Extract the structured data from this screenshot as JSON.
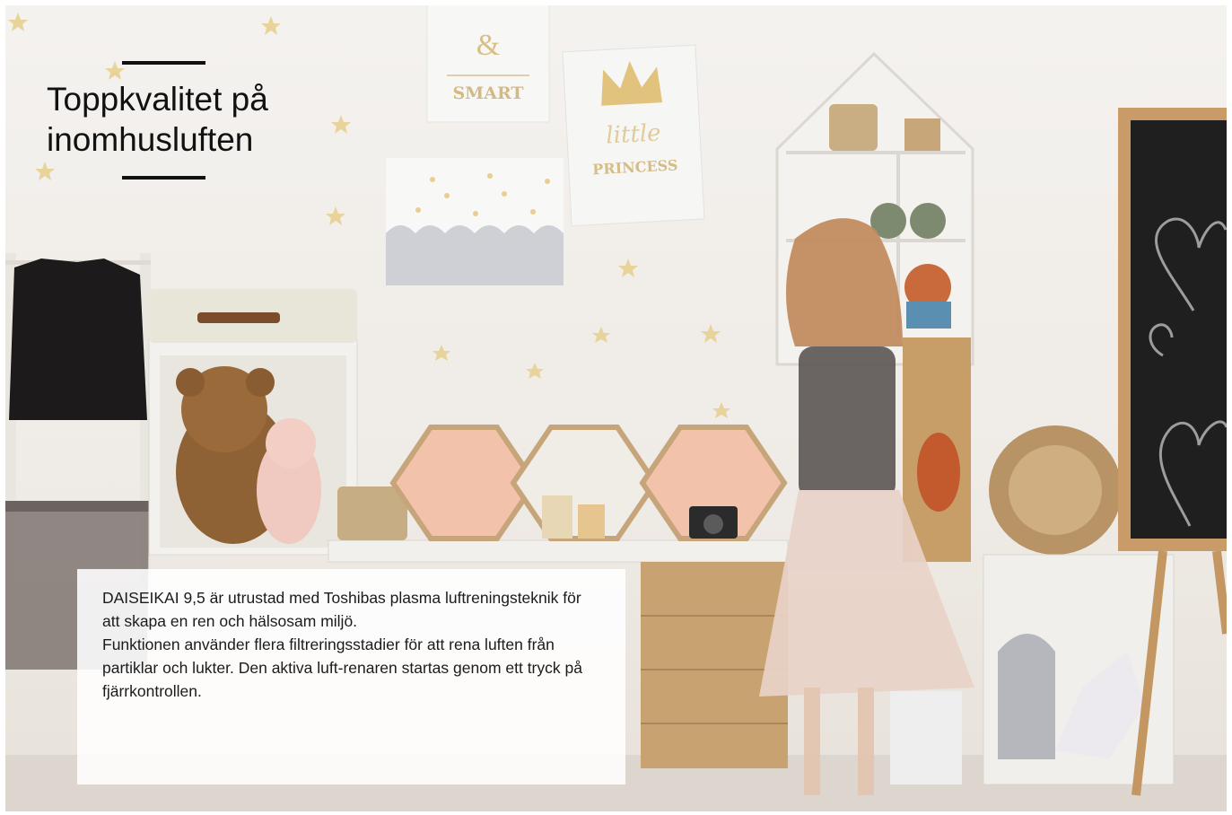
{
  "headline": {
    "line1": "Toppkvalitet på",
    "line2": "inomhusluften"
  },
  "body": {
    "paragraph1": "DAISEIKAI 9,5 är utrustad med Toshibas plasma luftreningsteknik för att skapa en ren och hälsosam miljö.",
    "paragraph2": "Funktionen använder flera filtreringsstadier för att rena luften från partiklar och lukter. Den aktiva luft-renaren startas genom ett tryck på fjärrkontrollen."
  },
  "posters": {
    "poster_top_symbol": "&",
    "poster_top_word": "SMART",
    "poster_crown_script": "little",
    "poster_crown_word": "PRINCESS"
  }
}
